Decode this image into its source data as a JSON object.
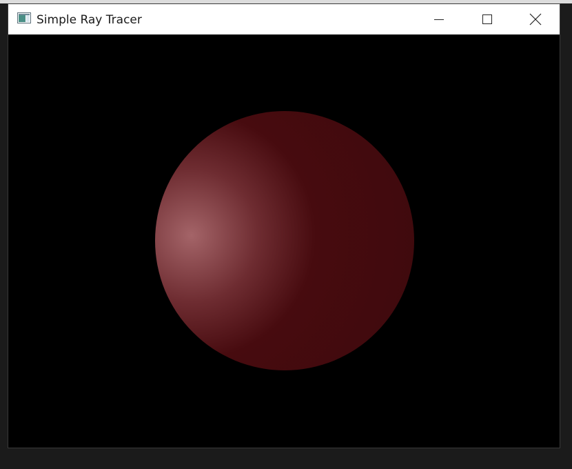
{
  "window": {
    "title": "Simple Ray Tracer",
    "app_icon": "window-app-icon",
    "controls": {
      "minimize_icon": "minimize-icon",
      "maximize_icon": "maximize-icon",
      "close_icon": "close-icon"
    }
  },
  "scene": {
    "background_color": "#000000",
    "sphere": {
      "base_color": "#470b0f",
      "highlight_color": "#a46468"
    }
  }
}
